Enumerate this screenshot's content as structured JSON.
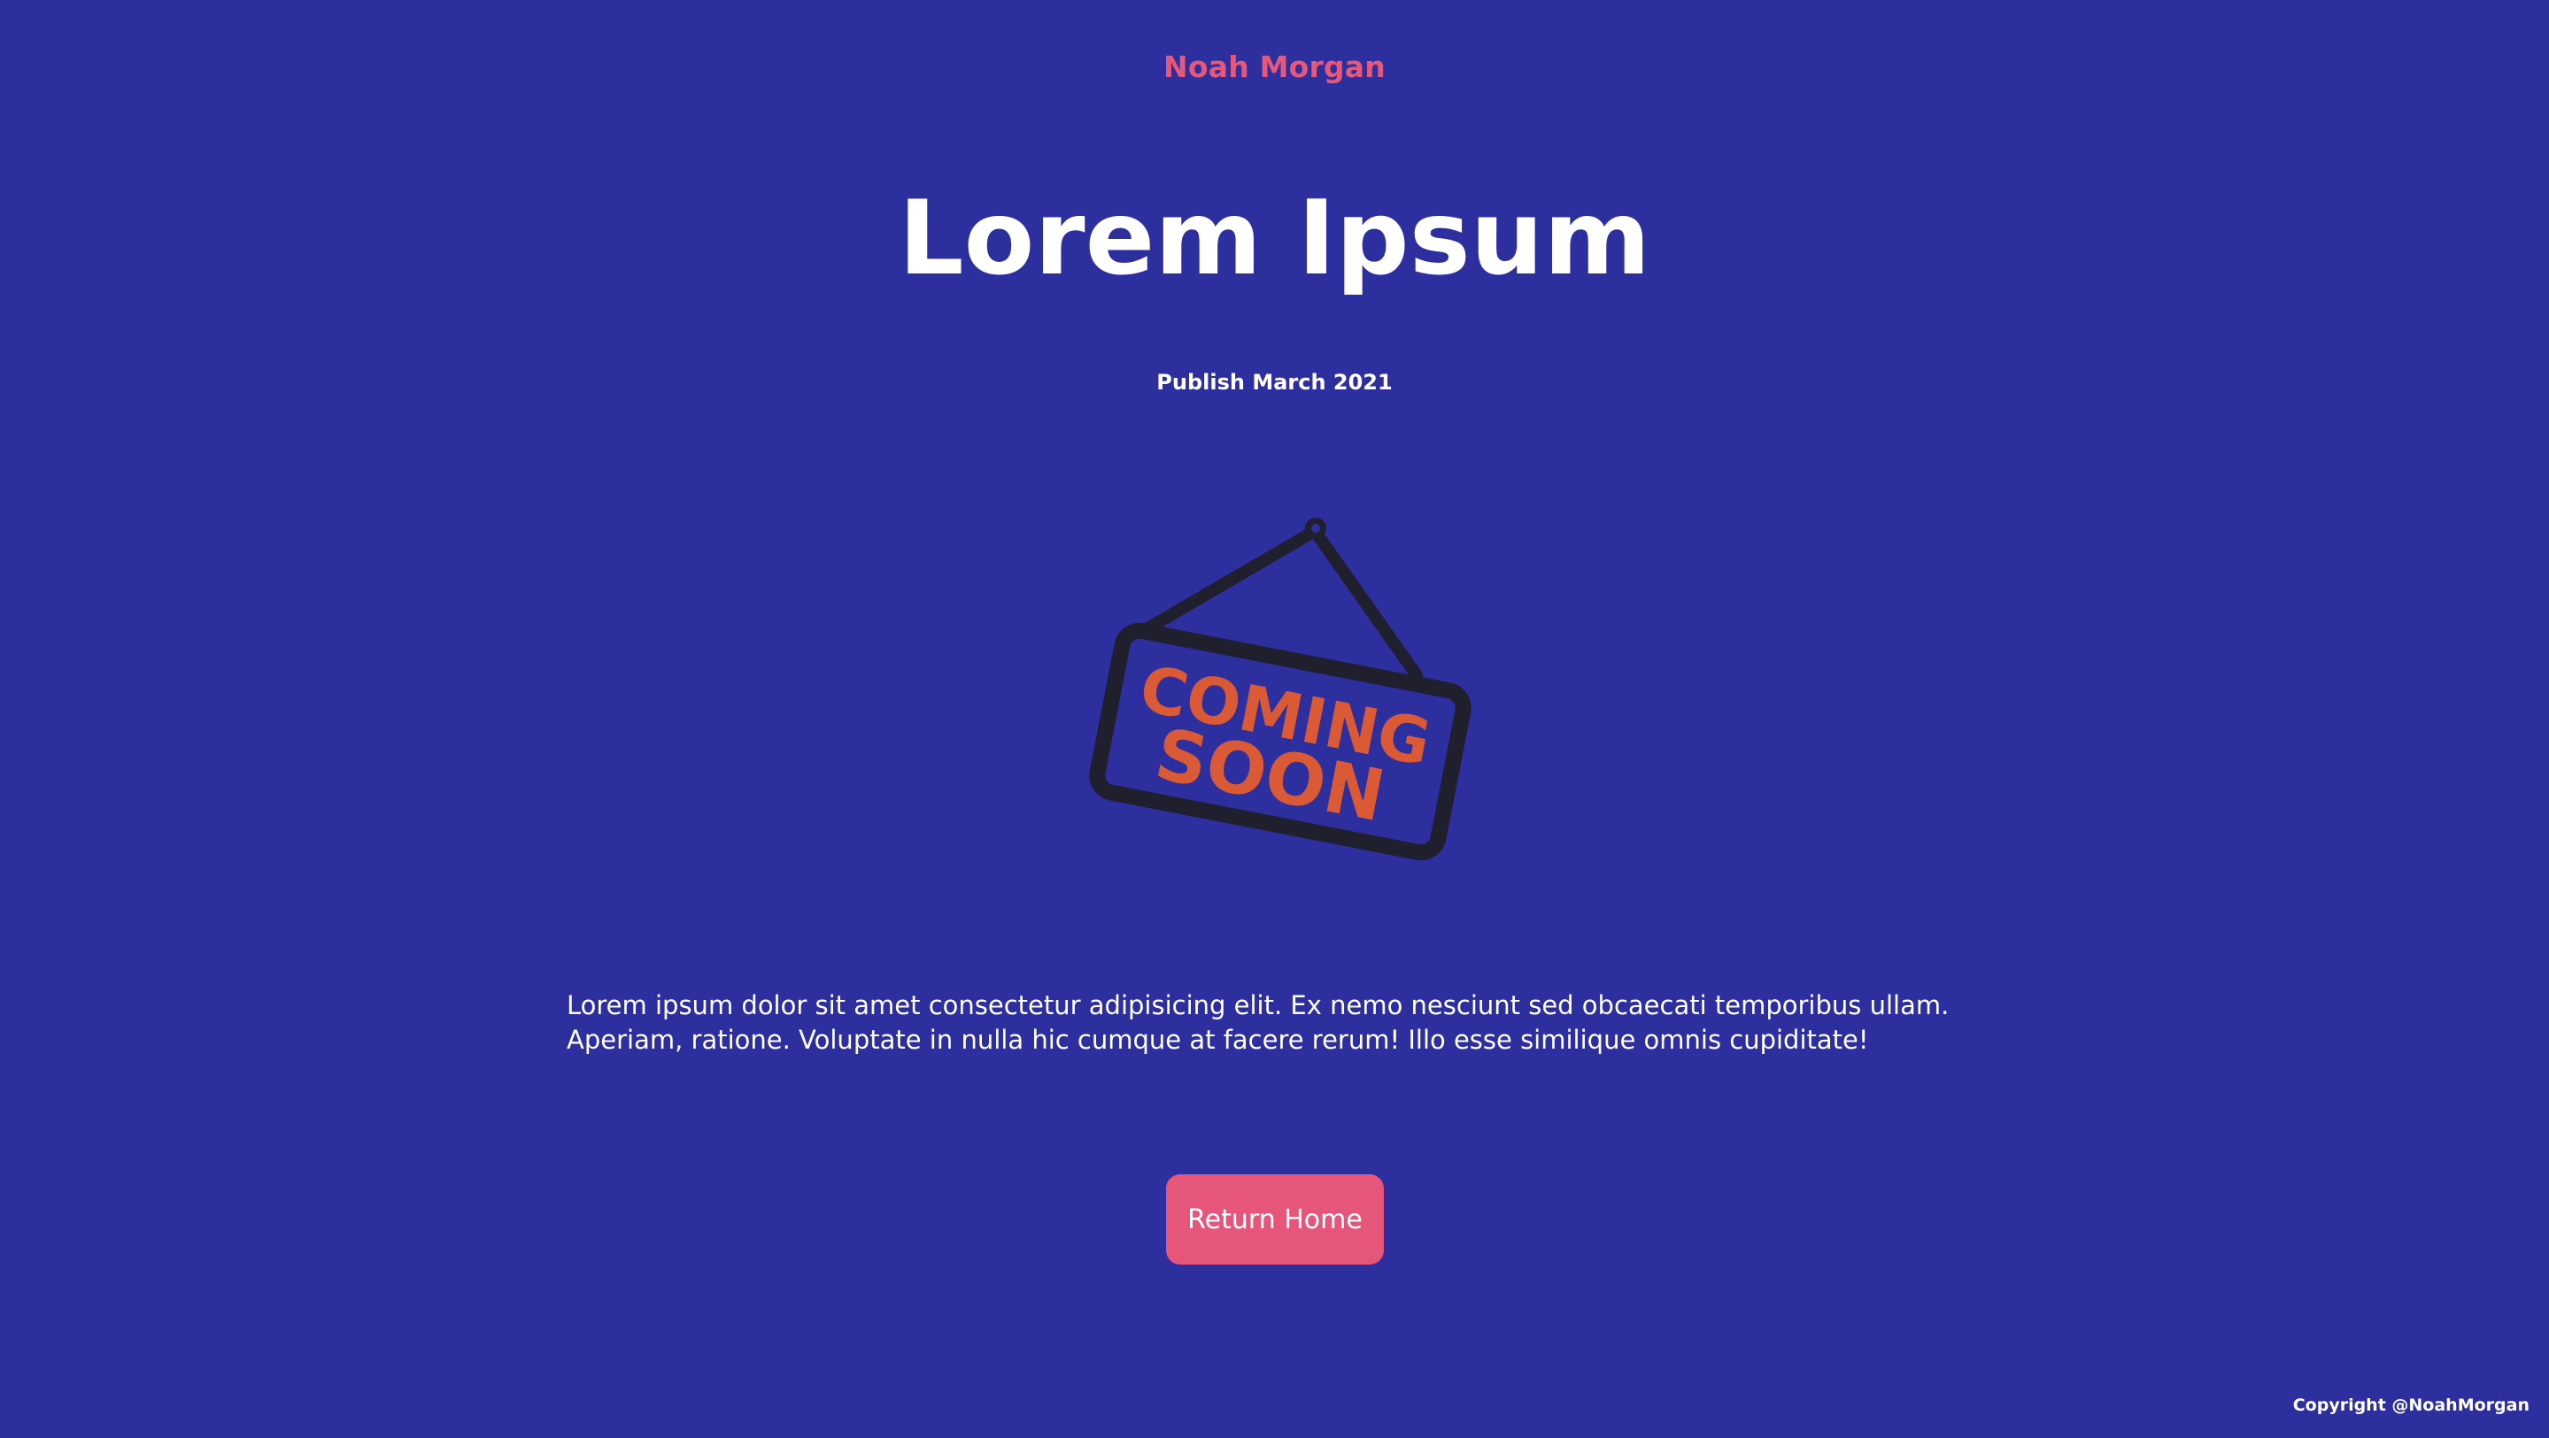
{
  "header": {
    "brand": "Noah Morgan"
  },
  "main": {
    "title": "Lorem Ipsum",
    "publish": "Publish March 2021",
    "illustration": {
      "icon": "coming-soon-sign-icon",
      "line1": "COMING",
      "line2": "SOON"
    },
    "description": "Lorem ipsum dolor sit amet consectetur adipisicing elit. Ex nemo nesciunt sed obcaecati temporibus ullam. Aperiam, ratione. Voluptate in nulla hic cumque at facere rerum! Illo esse similique omnis cupiditate!",
    "button_label": "Return Home"
  },
  "footer": {
    "copyright": "Copyright @NoahMorgan"
  },
  "colors": {
    "background": "#2e2f9e",
    "accent": "#e5567a",
    "sign_text": "#d95a35",
    "sign_frame": "#1f1f2e"
  }
}
